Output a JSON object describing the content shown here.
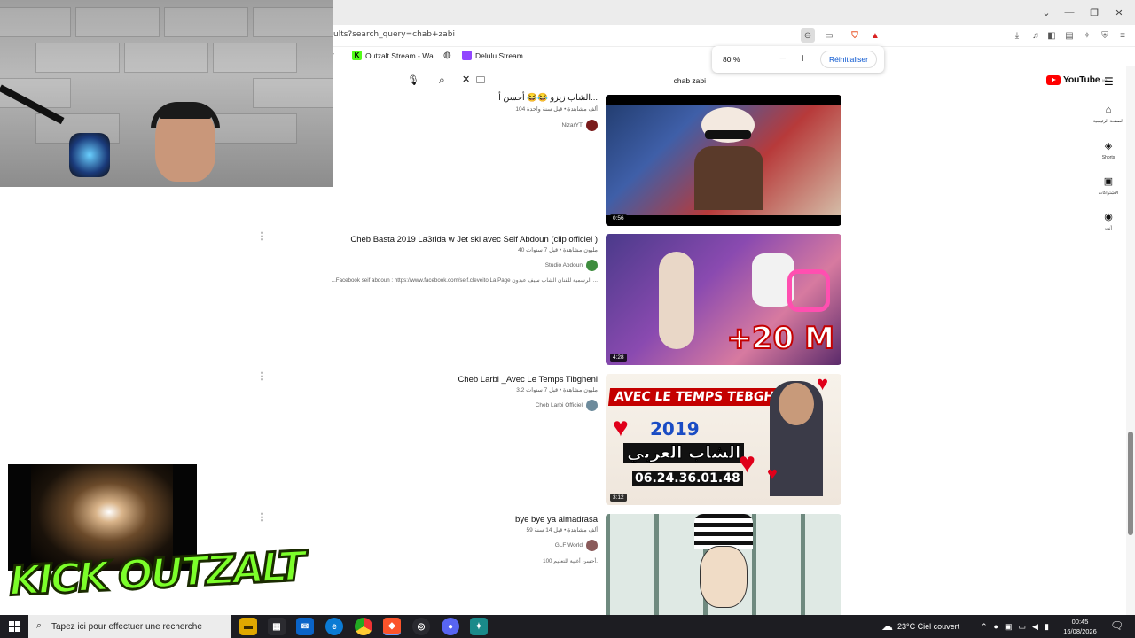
{
  "browser": {
    "url": "ults?search_query=chab+zabi",
    "bookmarks": [
      {
        "label": "Outzalt Stream - Wa...",
        "color": "#53fc18"
      },
      {
        "label": "Delulu Stream",
        "color": "#9146ff"
      }
    ],
    "bookmark_partial": "r",
    "zoom": {
      "level": "80 %",
      "minus": "−",
      "plus": "+",
      "reset_label": "Réinitialiser"
    }
  },
  "youtube": {
    "search_query": "chab zabi",
    "logo_text": "YouTube",
    "logo_region": "MA",
    "sidenav": [
      {
        "icon": "home-icon",
        "glyph": "⌂",
        "label": "الصفحة الرئيسية"
      },
      {
        "icon": "shorts-icon",
        "glyph": "◈",
        "label": "Shorts"
      },
      {
        "icon": "subscriptions-icon",
        "glyph": "▣",
        "label": "الاشتراكات"
      },
      {
        "icon": "you-icon",
        "glyph": "◉",
        "label": "أنت"
      }
    ]
  },
  "results": [
    {
      "title": "الشاب زيزو 😂😂 أحسن أ... ",
      "meta": "104 ألف مشاهدة • قبل سنة واحدة",
      "channel": "NizarYT",
      "avatar_color": "#7a1b1b",
      "duration": "0:56",
      "description": ""
    },
    {
      "title": "Cheb Basta 2019 La3rida w Jet ski avec Seif Abdoun (clip officiel )",
      "meta": "40 مليون مشاهدة • قبل 7 سنوات",
      "channel": "Studio Abdoun",
      "avatar_color": "#3f8d3f",
      "duration": "4:28",
      "description": "...Facebook seif abdoun : https://www.facebook.com/seif.cleveito La Page الرسمية للفنان الشاب سيف عبدون ... ",
      "thumb_text": "+20 M"
    },
    {
      "title": "Cheb Larbi _Avec Le Temps Tibgheni",
      "meta": "3.2 مليون مشاهدة • قبل 7 سنوات",
      "channel": "Cheb Larbi Officiel",
      "avatar_color": "#6d8b9c",
      "duration": "3:12",
      "description": "",
      "thumb_title": "AVEC LE TEMPS TEBGHINI",
      "thumb_year": "2019",
      "thumb_arabic": "الشاب العربي",
      "thumb_phone": "06.24.36.01.48"
    },
    {
      "title": "bye bye ya almadrasa",
      "meta": "59 ألف مشاهدة • قبل 14 سنة",
      "channel": "GLF World",
      "avatar_color": "#8a5a5a",
      "duration": "",
      "description": "أحسن أغنية للتعليم 100."
    }
  ],
  "overlay": {
    "brand_text": "KICK OUTZALT"
  },
  "taskbar": {
    "search_placeholder": "Tapez ici pour effectuer une recherche",
    "weather": "23°C  Ciel couvert",
    "time": "00:45",
    "date": "16/08/2026"
  },
  "colors": {
    "accent_blue": "#0b57d0",
    "youtube_red": "#ff0000",
    "kick_green": "#7cff2a",
    "taskbar": "#1d1d22"
  }
}
